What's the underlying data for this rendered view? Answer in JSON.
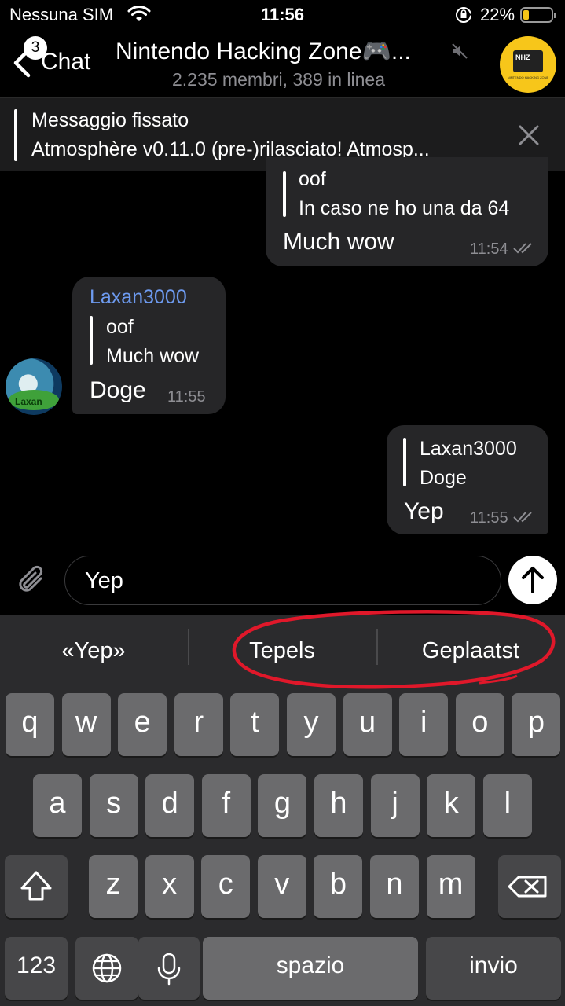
{
  "status_bar": {
    "carrier": "Nessuna SIM",
    "time": "11:56",
    "battery_percent": "22%",
    "battery_level": 0.22
  },
  "header": {
    "back_label": "Chat",
    "unread_badge": "3",
    "title": "Nintendo Hacking Zone🎮...",
    "subtitle": "2.235 membri, 389 in linea",
    "avatar_text": "NHZ",
    "avatar_caption": "NINTENDO HACKING ZONE"
  },
  "pinned": {
    "title": "Messaggio fissato",
    "text": "Atmosphère v0.11.0 (pre-)rilasciato! Atmosp..."
  },
  "messages": [
    {
      "reply_author": "oof",
      "reply_text": "In caso ne ho una da 64",
      "text": "Much wow",
      "time": "11:54"
    },
    {
      "sender": "Laxan3000",
      "reply_author": "oof",
      "reply_text": "Much wow",
      "text": "Doge",
      "time": "11:55",
      "avatar_text": "Laxan"
    },
    {
      "reply_author": "Laxan3000",
      "reply_text": "Doge",
      "text": "Yep",
      "time": "11:55"
    }
  ],
  "composer": {
    "value": "Yep"
  },
  "keyboard": {
    "suggestions": [
      "«Yep»",
      "Tepels",
      "Geplaatst"
    ],
    "row1": [
      "q",
      "w",
      "e",
      "r",
      "t",
      "y",
      "u",
      "i",
      "o",
      "p"
    ],
    "row2": [
      "a",
      "s",
      "d",
      "f",
      "g",
      "h",
      "j",
      "k",
      "l"
    ],
    "row3": [
      "z",
      "x",
      "c",
      "v",
      "b",
      "n",
      "m"
    ],
    "numbers_key": "123",
    "space_key": "spazio",
    "return_key": "invio"
  },
  "colors": {
    "accent_sender": "#6d9aef",
    "bubble": "#262628",
    "keyboard_bg": "#2b2b2d",
    "annotation_red": "#e0182a",
    "battery": "#f5c518"
  }
}
